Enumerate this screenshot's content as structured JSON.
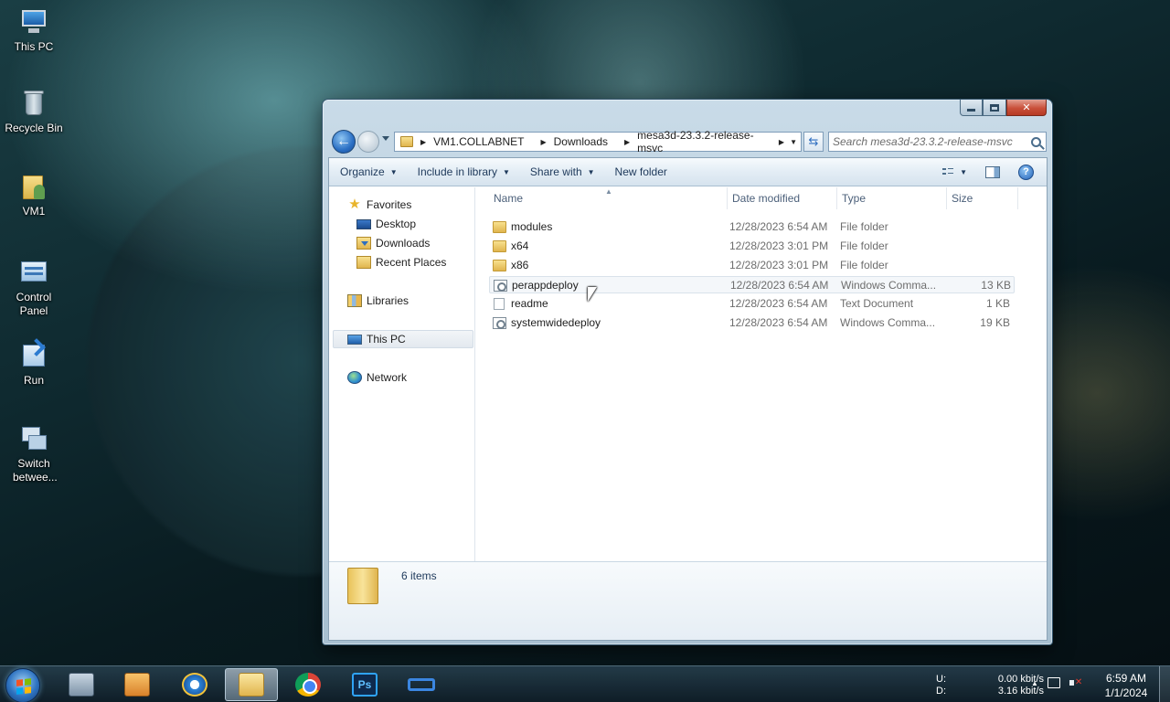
{
  "desktop": {
    "icons": [
      {
        "label": "This PC",
        "icon": "computer-icon"
      },
      {
        "label": "Recycle Bin",
        "icon": "recycle-bin-icon"
      },
      {
        "label": "VM1",
        "icon": "user-folder-icon"
      },
      {
        "label": "Control Panel",
        "icon": "control-panel-icon"
      },
      {
        "label": "Run",
        "icon": "run-icon"
      },
      {
        "label": "Switch betwee...",
        "icon": "switch-windows-icon"
      }
    ]
  },
  "explorer": {
    "breadcrumb": [
      "VM1.COLLABNET",
      "Downloads",
      "mesa3d-23.3.2-release-msvc"
    ],
    "search_placeholder": "Search mesa3d-23.3.2-release-msvc",
    "toolbar": {
      "organize": "Organize",
      "include_in_library": "Include in library",
      "share_with": "Share with",
      "new_folder": "New folder"
    },
    "nav": {
      "favorites": "Favorites",
      "desktop": "Desktop",
      "downloads": "Downloads",
      "recent_places": "Recent Places",
      "libraries": "Libraries",
      "this_pc": "This PC",
      "network": "Network"
    },
    "columns": {
      "name": "Name",
      "date": "Date modified",
      "type": "Type",
      "size": "Size"
    },
    "files": [
      {
        "name": "modules",
        "date": "12/28/2023 6:54 AM",
        "type": "File folder",
        "size": "",
        "icon": "folder-icon"
      },
      {
        "name": "x64",
        "date": "12/28/2023 3:01 PM",
        "type": "File folder",
        "size": "",
        "icon": "folder-icon"
      },
      {
        "name": "x86",
        "date": "12/28/2023 3:01 PM",
        "type": "File folder",
        "size": "",
        "icon": "folder-icon"
      },
      {
        "name": "perappdeploy",
        "date": "12/28/2023 6:54 AM",
        "type": "Windows Comma...",
        "size": "13 KB",
        "icon": "batch-file-icon"
      },
      {
        "name": "readme",
        "date": "12/28/2023 6:54 AM",
        "type": "Text Document",
        "size": "1 KB",
        "icon": "text-file-icon"
      },
      {
        "name": "systemwidedeploy",
        "date": "12/28/2023 6:54 AM",
        "type": "Windows Comma...",
        "size": "19 KB",
        "icon": "batch-file-icon"
      }
    ],
    "status": {
      "item_count": "6 items"
    }
  },
  "taskbar": {
    "apps": [
      "virtual-machine-icon",
      "media-player-icon",
      "internet-explorer-icon",
      "file-explorer-icon",
      "chrome-icon",
      "photoshop-icon",
      "loop-app-icon"
    ],
    "photoshop_label": "Ps",
    "net": {
      "up_label": "U:",
      "down_label": "D:",
      "up_speed": "0.00 kbit/s",
      "down_speed": "3.16 kbit/s"
    },
    "clock": {
      "time": "6:59 AM",
      "date": "1/1/2024"
    }
  }
}
